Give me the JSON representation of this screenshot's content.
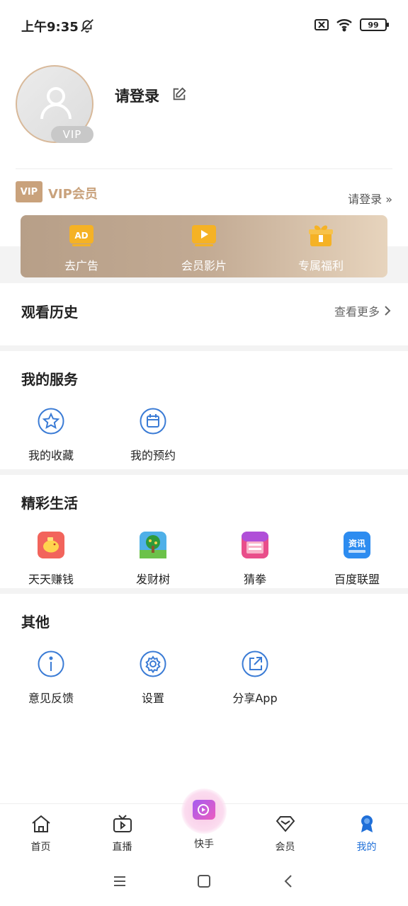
{
  "status": {
    "time": "上午9:35",
    "battery": "99"
  },
  "profile": {
    "login": "请登录",
    "vip_badge": "VIP"
  },
  "vip": {
    "logo": "VIP",
    "title": "VIP会员",
    "login": "请登录 »",
    "items": [
      {
        "label": "去广告",
        "icon": "ad-icon"
      },
      {
        "label": "会员影片",
        "icon": "video-icon"
      },
      {
        "label": "专属福利",
        "icon": "gift-icon"
      }
    ],
    "colors": {
      "gold": "#c9a27c"
    }
  },
  "history": {
    "title": "观看历史",
    "more": "查看更多"
  },
  "services": {
    "title": "我的服务",
    "items": [
      {
        "label": "我的收藏",
        "icon": "star-icon"
      },
      {
        "label": "我的预约",
        "icon": "calendar-icon"
      }
    ]
  },
  "life": {
    "title": "精彩生活",
    "items": [
      {
        "label": "天天赚钱",
        "icon": "piggy-bank-icon"
      },
      {
        "label": "发财树",
        "icon": "money-tree-icon"
      },
      {
        "label": "猜拳",
        "icon": "rock-paper-scissors-icon"
      },
      {
        "label": "百度联盟",
        "icon": "news-icon",
        "icon_text": "资讯"
      }
    ]
  },
  "other": {
    "title": "其他",
    "items": [
      {
        "label": "意见反馈",
        "icon": "info-icon"
      },
      {
        "label": "设置",
        "icon": "settings-icon"
      },
      {
        "label": "分享App",
        "icon": "share-icon"
      }
    ]
  },
  "tabs": [
    {
      "label": "首页",
      "icon": "home-icon"
    },
    {
      "label": "直播",
      "icon": "tv-icon"
    },
    {
      "label": "快手",
      "icon": "kuaishou-icon"
    },
    {
      "label": "会员",
      "icon": "diamond-icon"
    },
    {
      "label": "我的",
      "icon": "medal-icon",
      "active": true
    }
  ],
  "accent": "#1f6fd8",
  "icon_blue": "#3a7bd5"
}
